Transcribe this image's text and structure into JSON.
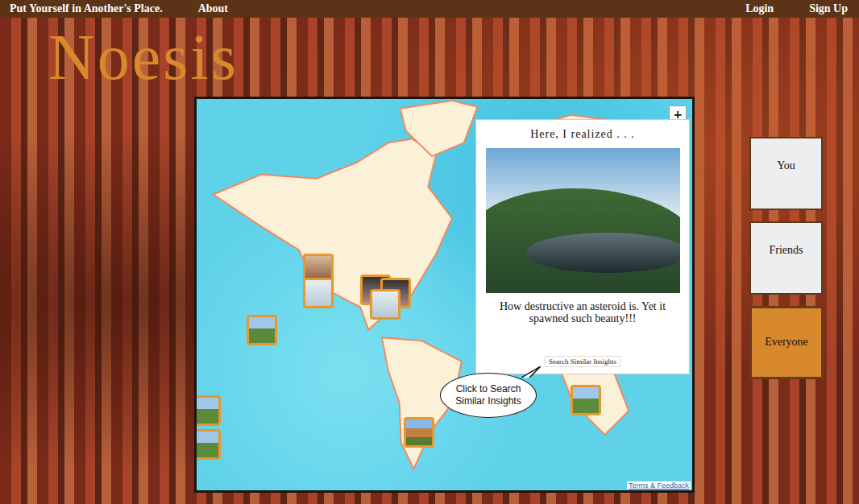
{
  "nav": {
    "tagline": "Put Yourself in Another's Place.",
    "links": [
      "About"
    ],
    "auth": [
      "Login",
      "Sign Up"
    ]
  },
  "logo": "Noesis",
  "map": {
    "zoom": [
      "+",
      "−"
    ],
    "footer_link": "Terms & Feedback"
  },
  "popup": {
    "title": "Here, I realized . . .",
    "insight": "How destructive an asteroid is. Yet it spawned such beauty!!!",
    "button": "Search Similar Insights"
  },
  "tooltip": "Click to Search Similar Insights",
  "filters": [
    {
      "label": "You",
      "selected": false
    },
    {
      "label": "Friends",
      "selected": false
    },
    {
      "label": "Everyone",
      "selected": true
    }
  ]
}
